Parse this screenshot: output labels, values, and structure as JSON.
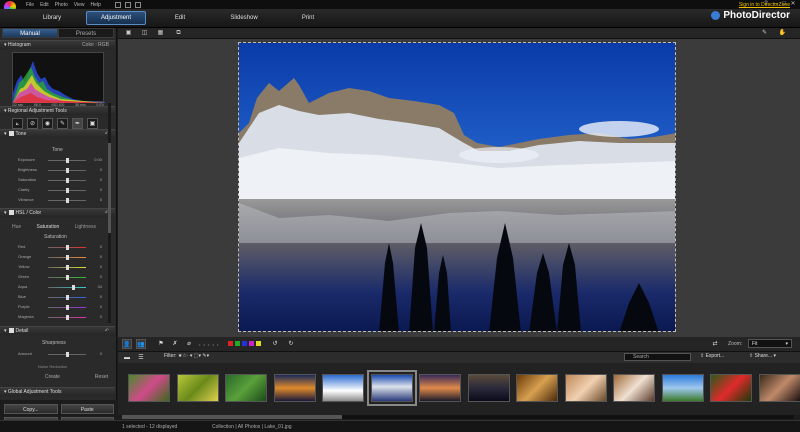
{
  "app": {
    "brand": "PhotoDirector",
    "signin": "Sign in to DirectorZone"
  },
  "menu": [
    "File",
    "Edit",
    "Photo",
    "View",
    "Help"
  ],
  "window_controls": [
    "?",
    "–",
    "□",
    "✕"
  ],
  "modules": [
    {
      "label": "Library",
      "active": false
    },
    {
      "label": "Adjustment",
      "active": true
    },
    {
      "label": "Edit",
      "active": false
    },
    {
      "label": "Slideshow",
      "active": false
    },
    {
      "label": "Print",
      "active": false
    }
  ],
  "left_panel": {
    "tabs": [
      {
        "label": "Manual",
        "active": true
      },
      {
        "label": "Presets",
        "active": false
      }
    ],
    "histogram": {
      "title": "Histogram",
      "mode": "Color : RGB",
      "labels": [
        "1/2 sec",
        "f/8.0",
        "ISO 100",
        "35 mm",
        "0 EV"
      ]
    },
    "regional": {
      "title": "Regional Adjustment Tools",
      "tools": [
        "⟀",
        "⊘",
        "◉",
        "✎",
        "✒",
        "▣"
      ]
    },
    "tone": {
      "title": "Tone",
      "sub": "Tone",
      "sliders": [
        {
          "label": "Exposure",
          "value": "0.00",
          "pos": 0.5
        },
        {
          "label": "Brightness",
          "value": "0",
          "pos": 0.5
        },
        {
          "label": "Saturation",
          "value": "0",
          "pos": 0.5
        },
        {
          "label": "Clarity",
          "value": "0",
          "pos": 0.5
        },
        {
          "label": "Vibrance",
          "value": "0",
          "pos": 0.5
        }
      ]
    },
    "hsl": {
      "title": "HSL / Color",
      "tabs": [
        {
          "label": "Hue",
          "active": false
        },
        {
          "label": "Saturation",
          "active": true
        },
        {
          "label": "Lightness",
          "active": false
        }
      ],
      "sub": "Saturation",
      "sliders": [
        {
          "label": "Red",
          "value": "0",
          "pos": 0.5,
          "color": "#d33"
        },
        {
          "label": "Orange",
          "value": "0",
          "pos": 0.5,
          "color": "#e83"
        },
        {
          "label": "Yellow",
          "value": "0",
          "pos": 0.5,
          "color": "#dd3"
        },
        {
          "label": "Green",
          "value": "0",
          "pos": 0.5,
          "color": "#3b3"
        },
        {
          "label": "Aqua",
          "value": "34",
          "pos": 0.67,
          "color": "#3cc"
        },
        {
          "label": "Blue",
          "value": "0",
          "pos": 0.5,
          "color": "#36d"
        },
        {
          "label": "Purple",
          "value": "0",
          "pos": 0.5,
          "color": "#93d"
        },
        {
          "label": "Magenta",
          "value": "0",
          "pos": 0.5,
          "color": "#d3a"
        }
      ]
    },
    "detail": {
      "title": "Detail",
      "sub": "Sharpness",
      "sliders": [
        {
          "label": "Amount",
          "value": "0",
          "pos": 0.5
        }
      ]
    },
    "noise_partial": "Noise Reduction",
    "foot": [
      "Create",
      "Reset"
    ],
    "global": {
      "title": "Global Adjustment Tools"
    },
    "buttons": [
      "Copy...",
      "Paste",
      "Reset",
      "Create..."
    ]
  },
  "controls": {
    "zoom_label": "Zoom:",
    "zoom_value": "Fit",
    "stars": "• • • • •",
    "color_labels": [
      "#d22",
      "#2a2",
      "#23d",
      "#c2c",
      "#dd2"
    ]
  },
  "filmstrip_bar": {
    "filter": "Filter:",
    "search_placeholder": "Search",
    "export": "Export...",
    "share": "Share..."
  },
  "thumbnails": [
    {
      "name": "flowers",
      "selected": false
    },
    {
      "name": "butterfly",
      "selected": false
    },
    {
      "name": "garden",
      "selected": false
    },
    {
      "name": "sunset-sea",
      "selected": false
    },
    {
      "name": "white-church",
      "selected": false
    },
    {
      "name": "lake-mountain",
      "selected": true
    },
    {
      "name": "sunset-clouds",
      "selected": false
    },
    {
      "name": "beach-dusk",
      "selected": false
    },
    {
      "name": "indoor-warm",
      "selected": false
    },
    {
      "name": "child",
      "selected": false
    },
    {
      "name": "baby",
      "selected": false
    },
    {
      "name": "blue-sky",
      "selected": false
    },
    {
      "name": "red-flower",
      "selected": false
    },
    {
      "name": "portrait",
      "selected": false
    }
  ],
  "status": {
    "left": "1 selected - 12 displayed",
    "center": "Collection | All Photos | Lake_01.jpg"
  }
}
